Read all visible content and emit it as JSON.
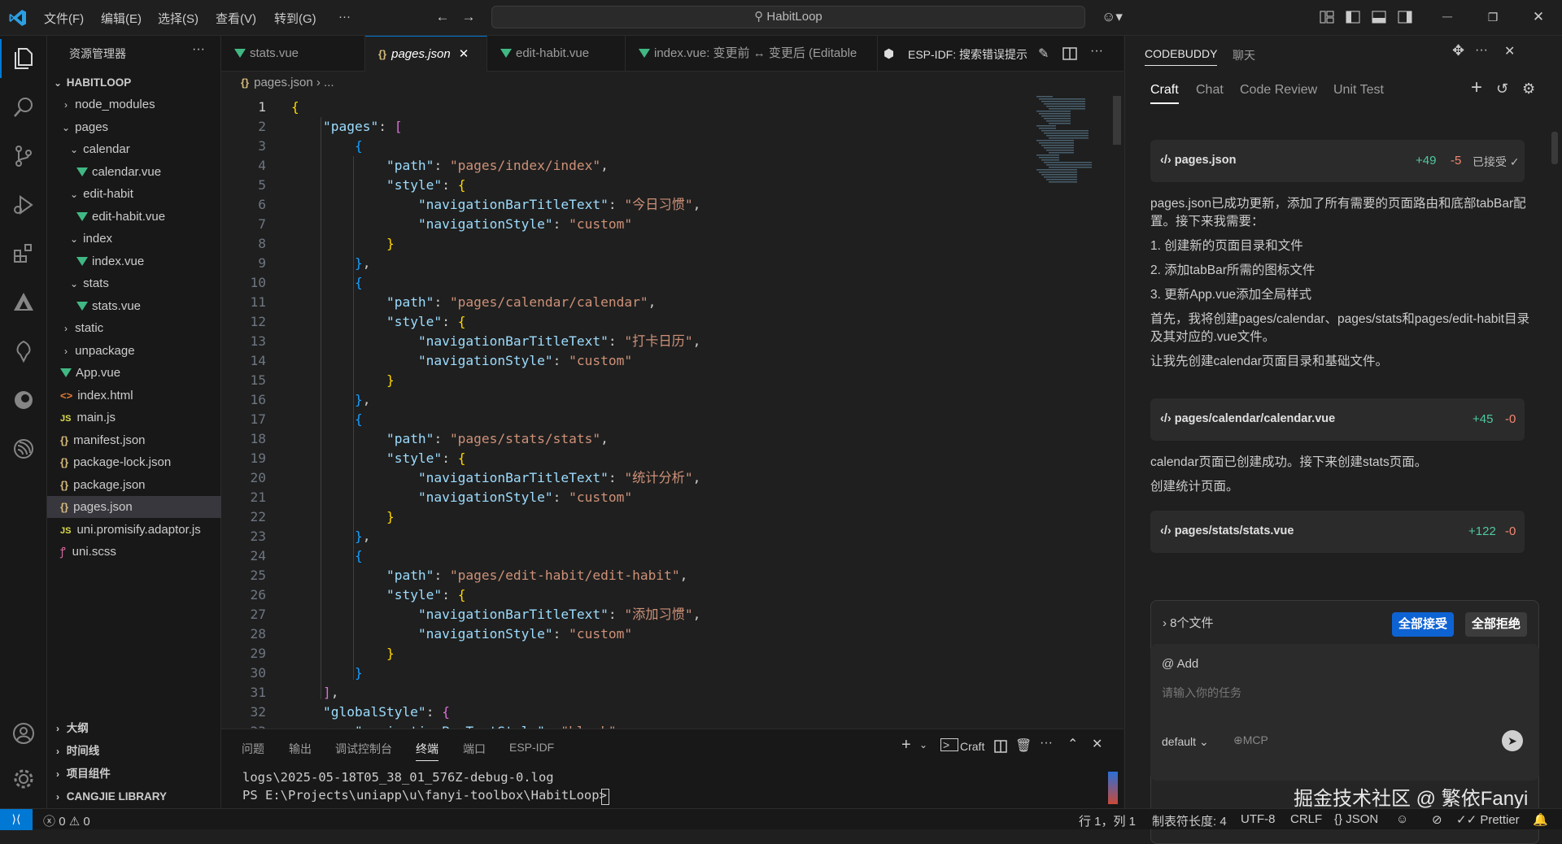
{
  "titlebar": {
    "menus": [
      "文件(F)",
      "编辑(E)",
      "选择(S)",
      "查看(V)",
      "转到(G)",
      "···"
    ],
    "search": "HabitLoop"
  },
  "explorer": {
    "title": "资源管理器",
    "root": "HABITLOOP",
    "items": [
      {
        "label": "node_modules",
        "type": "folder",
        "indent": 1,
        "open": false
      },
      {
        "label": "pages",
        "type": "folder",
        "indent": 1,
        "open": true
      },
      {
        "label": "calendar",
        "type": "folder",
        "indent": 2,
        "open": true
      },
      {
        "label": "calendar.vue",
        "type": "vue",
        "indent": 3
      },
      {
        "label": "edit-habit",
        "type": "folder",
        "indent": 2,
        "open": true
      },
      {
        "label": "edit-habit.vue",
        "type": "vue",
        "indent": 3
      },
      {
        "label": "index",
        "type": "folder",
        "indent": 2,
        "open": true
      },
      {
        "label": "index.vue",
        "type": "vue",
        "indent": 3
      },
      {
        "label": "stats",
        "type": "folder",
        "indent": 2,
        "open": true
      },
      {
        "label": "stats.vue",
        "type": "vue",
        "indent": 3
      },
      {
        "label": "static",
        "type": "folder",
        "indent": 1,
        "open": false
      },
      {
        "label": "unpackage",
        "type": "folder",
        "indent": 1,
        "open": false
      },
      {
        "label": "App.vue",
        "type": "vue",
        "indent": 1
      },
      {
        "label": "index.html",
        "type": "html",
        "indent": 1
      },
      {
        "label": "main.js",
        "type": "js",
        "indent": 1
      },
      {
        "label": "manifest.json",
        "type": "json",
        "indent": 1
      },
      {
        "label": "package-lock.json",
        "type": "json",
        "indent": 1
      },
      {
        "label": "package.json",
        "type": "json",
        "indent": 1
      },
      {
        "label": "pages.json",
        "type": "json",
        "indent": 1,
        "selected": true
      },
      {
        "label": "uni.promisify.adaptor.js",
        "type": "js",
        "indent": 1
      },
      {
        "label": "uni.scss",
        "type": "scss",
        "indent": 1
      }
    ],
    "sections": [
      "大纲",
      "时间线",
      "项目组件",
      "CANGJIE LIBRARY"
    ]
  },
  "tabs": [
    {
      "label": "stats.vue",
      "icon": "vue"
    },
    {
      "label": "pages.json",
      "icon": "json",
      "active": true
    },
    {
      "label": "edit-habit.vue",
      "icon": "vue"
    },
    {
      "label": "index.vue: 变更前 ↔ 变更后 (Editable",
      "icon": "vue"
    }
  ],
  "tab_extra": "ESP-IDF:  搜索错误提示",
  "breadcrumb": [
    "pages.json",
    "..."
  ],
  "code": [
    [
      [
        "b1",
        "{"
      ]
    ],
    [
      [
        "p",
        "    "
      ],
      [
        "k",
        "\"pages\""
      ],
      [
        "p",
        ": "
      ],
      [
        "b2",
        "["
      ]
    ],
    [
      [
        "p",
        "        "
      ],
      [
        "b3",
        "{"
      ]
    ],
    [
      [
        "p",
        "            "
      ],
      [
        "k",
        "\"path\""
      ],
      [
        "p",
        ": "
      ],
      [
        "s",
        "\"pages/index/index\""
      ],
      [
        "p",
        ","
      ]
    ],
    [
      [
        "p",
        "            "
      ],
      [
        "k",
        "\"style\""
      ],
      [
        "p",
        ": "
      ],
      [
        "b1",
        "{"
      ]
    ],
    [
      [
        "p",
        "                "
      ],
      [
        "k",
        "\"navigationBarTitleText\""
      ],
      [
        "p",
        ": "
      ],
      [
        "s",
        "\"今日习惯\""
      ],
      [
        "p",
        ","
      ]
    ],
    [
      [
        "p",
        "                "
      ],
      [
        "k",
        "\"navigationStyle\""
      ],
      [
        "p",
        ": "
      ],
      [
        "s",
        "\"custom\""
      ]
    ],
    [
      [
        "p",
        "            "
      ],
      [
        "b1",
        "}"
      ]
    ],
    [
      [
        "p",
        "        "
      ],
      [
        "b3",
        "}"
      ],
      [
        "p",
        ","
      ]
    ],
    [
      [
        "p",
        "        "
      ],
      [
        "b3",
        "{"
      ]
    ],
    [
      [
        "p",
        "            "
      ],
      [
        "k",
        "\"path\""
      ],
      [
        "p",
        ": "
      ],
      [
        "s",
        "\"pages/calendar/calendar\""
      ],
      [
        "p",
        ","
      ]
    ],
    [
      [
        "p",
        "            "
      ],
      [
        "k",
        "\"style\""
      ],
      [
        "p",
        ": "
      ],
      [
        "b1",
        "{"
      ]
    ],
    [
      [
        "p",
        "                "
      ],
      [
        "k",
        "\"navigationBarTitleText\""
      ],
      [
        "p",
        ": "
      ],
      [
        "s",
        "\"打卡日历\""
      ],
      [
        "p",
        ","
      ]
    ],
    [
      [
        "p",
        "                "
      ],
      [
        "k",
        "\"navigationStyle\""
      ],
      [
        "p",
        ": "
      ],
      [
        "s",
        "\"custom\""
      ]
    ],
    [
      [
        "p",
        "            "
      ],
      [
        "b1",
        "}"
      ]
    ],
    [
      [
        "p",
        "        "
      ],
      [
        "b3",
        "}"
      ],
      [
        "p",
        ","
      ]
    ],
    [
      [
        "p",
        "        "
      ],
      [
        "b3",
        "{"
      ]
    ],
    [
      [
        "p",
        "            "
      ],
      [
        "k",
        "\"path\""
      ],
      [
        "p",
        ": "
      ],
      [
        "s",
        "\"pages/stats/stats\""
      ],
      [
        "p",
        ","
      ]
    ],
    [
      [
        "p",
        "            "
      ],
      [
        "k",
        "\"style\""
      ],
      [
        "p",
        ": "
      ],
      [
        "b1",
        "{"
      ]
    ],
    [
      [
        "p",
        "                "
      ],
      [
        "k",
        "\"navigationBarTitleText\""
      ],
      [
        "p",
        ": "
      ],
      [
        "s",
        "\"统计分析\""
      ],
      [
        "p",
        ","
      ]
    ],
    [
      [
        "p",
        "                "
      ],
      [
        "k",
        "\"navigationStyle\""
      ],
      [
        "p",
        ": "
      ],
      [
        "s",
        "\"custom\""
      ]
    ],
    [
      [
        "p",
        "            "
      ],
      [
        "b1",
        "}"
      ]
    ],
    [
      [
        "p",
        "        "
      ],
      [
        "b3",
        "}"
      ],
      [
        "p",
        ","
      ]
    ],
    [
      [
        "p",
        "        "
      ],
      [
        "b3",
        "{"
      ]
    ],
    [
      [
        "p",
        "            "
      ],
      [
        "k",
        "\"path\""
      ],
      [
        "p",
        ": "
      ],
      [
        "s",
        "\"pages/edit-habit/edit-habit\""
      ],
      [
        "p",
        ","
      ]
    ],
    [
      [
        "p",
        "            "
      ],
      [
        "k",
        "\"style\""
      ],
      [
        "p",
        ": "
      ],
      [
        "b1",
        "{"
      ]
    ],
    [
      [
        "p",
        "                "
      ],
      [
        "k",
        "\"navigationBarTitleText\""
      ],
      [
        "p",
        ": "
      ],
      [
        "s",
        "\"添加习惯\""
      ],
      [
        "p",
        ","
      ]
    ],
    [
      [
        "p",
        "                "
      ],
      [
        "k",
        "\"navigationStyle\""
      ],
      [
        "p",
        ": "
      ],
      [
        "s",
        "\"custom\""
      ]
    ],
    [
      [
        "p",
        "            "
      ],
      [
        "b1",
        "}"
      ]
    ],
    [
      [
        "p",
        "        "
      ],
      [
        "b3",
        "}"
      ]
    ],
    [
      [
        "p",
        "    "
      ],
      [
        "b2",
        "]"
      ],
      [
        "p",
        ","
      ]
    ],
    [
      [
        "p",
        "    "
      ],
      [
        "k",
        "\"globalStyle\""
      ],
      [
        "p",
        ": "
      ],
      [
        "b2",
        "{"
      ]
    ],
    [
      [
        "p",
        "        "
      ],
      [
        "k",
        "\"navigationBarTextStyle\""
      ],
      [
        "p",
        ": "
      ],
      [
        "s",
        "\"black\""
      ],
      [
        "p",
        ","
      ]
    ]
  ],
  "panel": {
    "tabs": [
      "问题",
      "输出",
      "调试控制台",
      "终端",
      "端口",
      "ESP-IDF"
    ],
    "active_tab": "终端",
    "craft_label": "Craft",
    "terminal_lines": [
      "logs\\2025-05-18T05_38_01_576Z-debug-0.log",
      "PS E:\\Projects\\uniapp\\u\\fanyi-toolbox\\HabitLoop> "
    ]
  },
  "codebuddy": {
    "header_tabs": [
      "CODEBUDDY",
      "聊天"
    ],
    "mode_tabs": [
      "Craft",
      "Chat",
      "Code Review",
      "Unit Test"
    ],
    "active_mode": "Craft",
    "card1": {
      "file": "pages.json",
      "add": "+49",
      "del": "-5",
      "status": "已接受 ✓"
    },
    "msg1": [
      "pages.json已成功更新，添加了所有需要的页面路由和底部tabBar配置。接下来我需要：",
      "1. 创建新的页面目录和文件",
      "2. 添加tabBar所需的图标文件",
      "3. 更新App.vue添加全局样式",
      "首先，我将创建pages/calendar、pages/stats和pages/edit-habit目录及其对应的.vue文件。",
      "让我先创建calendar页面目录和基础文件。"
    ],
    "card2": {
      "file": "pages/calendar/calendar.vue",
      "add": "+45",
      "del": "-0"
    },
    "msg2": [
      "calendar页面已创建成功。接下来创建stats页面。",
      "创建统计页面。"
    ],
    "card3": {
      "file": "pages/stats/stats.vue",
      "add": "+122",
      "del": "-0"
    },
    "changes_label": "8个文件",
    "accept_all": "全部接受",
    "reject_all": "全部拒绝",
    "add_label": "@ Add",
    "input_placeholder": "请输入你的任务",
    "model": "default",
    "mcp": "MCP"
  },
  "statusbar": {
    "errors": "0",
    "warnings": "0",
    "position": "行 1，列 1",
    "tabsize": "制表符长度: 4",
    "encoding": "UTF-8",
    "eol": "CRLF",
    "language": "JSON",
    "formatter": "Prettier"
  },
  "watermark": "掘金技术社区 @ 繁依Fanyi",
  "colors": {
    "accent": "#0078d4",
    "vue": "#41b883",
    "add": "#4ec9a0",
    "del": "#f48771",
    "button": "#0e63d3"
  }
}
